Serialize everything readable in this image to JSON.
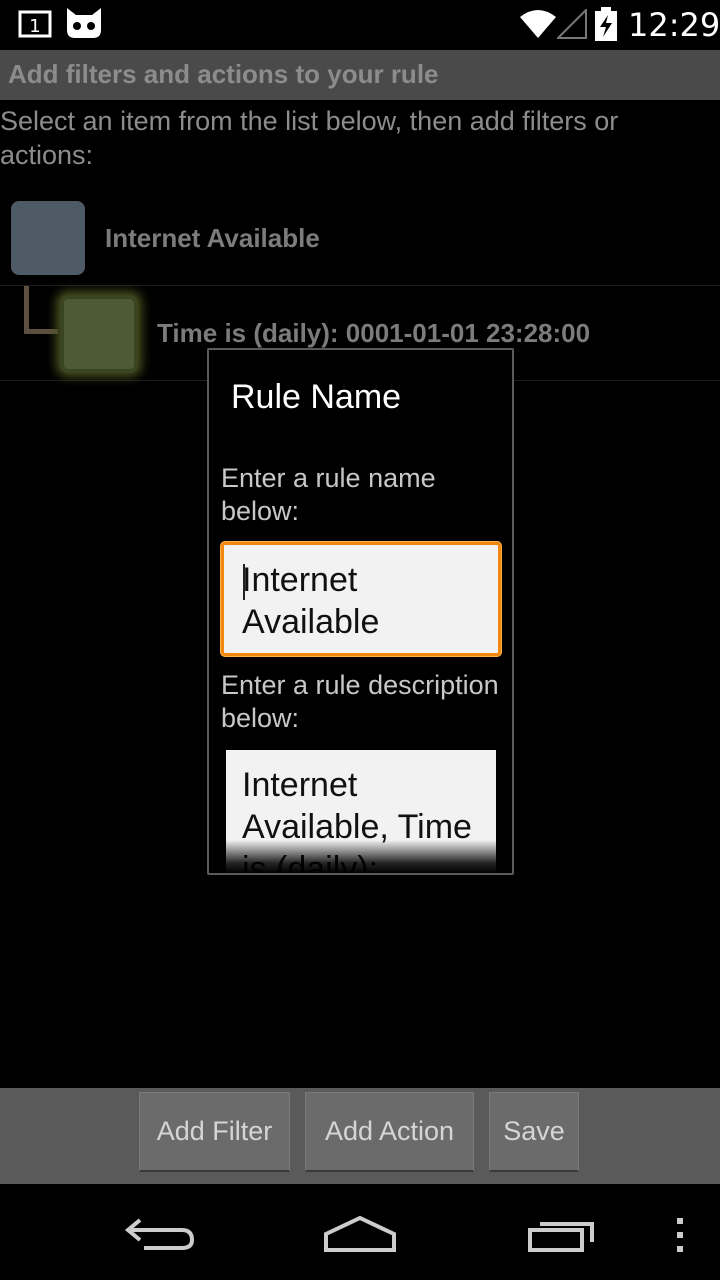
{
  "status_bar": {
    "notification_count": "1",
    "time": "12:29",
    "icons": [
      "notification-icon",
      "cyanogen-cat-icon",
      "wifi-icon",
      "signal-icon",
      "battery-charging-icon"
    ]
  },
  "header": {
    "title": "Add filters and actions to your rule"
  },
  "instruction": "Select an item from the list below, then add filters or actions:",
  "tree": {
    "items": [
      {
        "label": "Internet Available",
        "color": "#4f5a67"
      },
      {
        "label": "Time is (daily): 0001-01-01 23:28:00",
        "color": "#4d5a34"
      }
    ]
  },
  "dialog": {
    "title": "Rule Name",
    "name_label": "Enter a rule name below:",
    "name_value": "Internet Available",
    "desc_label": "Enter a rule description below:",
    "desc_value": "Internet Available, Time is (daily):",
    "accent_color": "#f0870f"
  },
  "buttons": {
    "add_filter": "Add Filter",
    "add_action": "Add Action",
    "save": "Save"
  },
  "nav": {
    "icons": [
      "back-icon",
      "home-icon",
      "recent-apps-icon",
      "overflow-menu-icon"
    ]
  }
}
